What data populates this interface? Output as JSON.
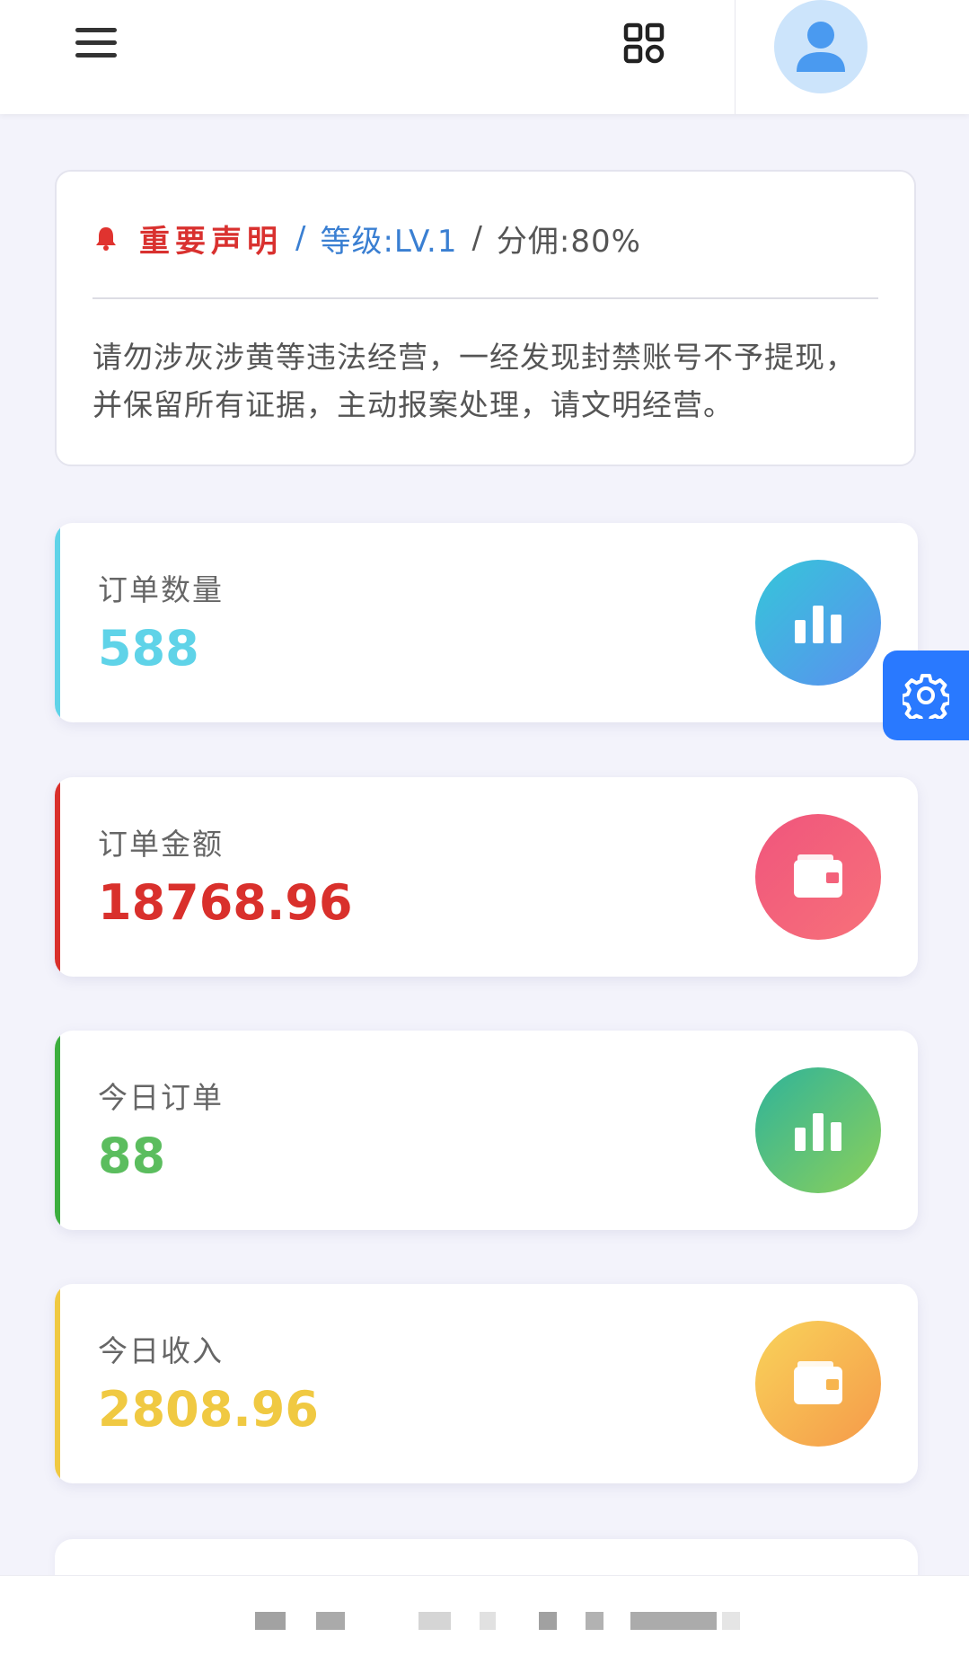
{
  "header": {
    "menu_icon": "hamburger-menu-icon",
    "grid_icon": "app-grid-icon",
    "avatar_icon": "user-avatar-icon"
  },
  "notice": {
    "bell_icon": "bell-icon",
    "title": "重要声明",
    "separator": "/",
    "level": "等级:LV.1",
    "commission": "分佣:80%",
    "body": "请勿涉灰涉黄等违法经营，一经发现封禁账号不予提现，并保留所有证据，主动报案处理，请文明经营。"
  },
  "stats": [
    {
      "label": "订单数量",
      "value": "588",
      "color": "#5fd3e8",
      "icon": "bar-chart-icon",
      "gradient": [
        "#35c6d9",
        "#5b8ff0"
      ]
    },
    {
      "label": "订单金额",
      "value": "18768.96",
      "color": "#d9302c",
      "icon": "wallet-icon",
      "gradient": [
        "#f0557c",
        "#f7717a"
      ]
    },
    {
      "label": "今日订单",
      "value": "88",
      "color": "#5bbd5e",
      "icon": "bar-chart-icon",
      "gradient": [
        "#2fb39a",
        "#8bd05a"
      ]
    },
    {
      "label": "今日收入",
      "value": "2808.96",
      "color": "#f0c942",
      "icon": "wallet-icon",
      "gradient": [
        "#f9d35a",
        "#f59a4a"
      ]
    }
  ],
  "floating_settings": {
    "icon": "gear-icon",
    "color": "#2979ff"
  }
}
